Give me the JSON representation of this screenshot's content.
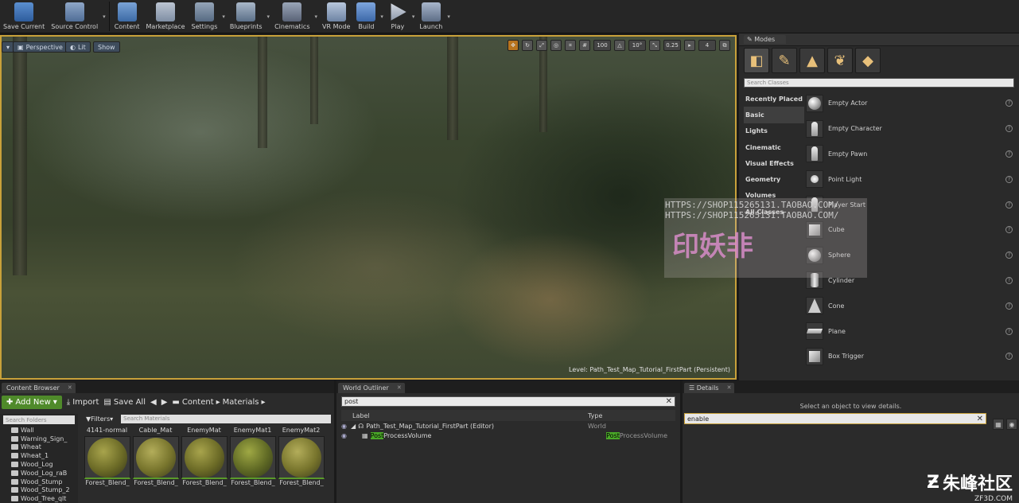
{
  "toolbar": {
    "items": [
      {
        "label": "Save Current",
        "icon": "save-icon"
      },
      {
        "label": "Source Control",
        "icon": "source-control-icon"
      },
      {
        "label": "Content",
        "icon": "content-icon"
      },
      {
        "label": "Marketplace",
        "icon": "marketplace-icon"
      },
      {
        "label": "Settings",
        "icon": "settings-icon"
      },
      {
        "label": "Blueprints",
        "icon": "blueprints-icon"
      },
      {
        "label": "Cinematics",
        "icon": "cinematics-icon"
      },
      {
        "label": "VR Mode",
        "icon": "vr-mode-icon"
      },
      {
        "label": "Build",
        "icon": "build-icon"
      },
      {
        "label": "Play",
        "icon": "play-icon"
      },
      {
        "label": "Launch",
        "icon": "launch-icon"
      }
    ]
  },
  "viewport": {
    "perspective_label": "Perspective",
    "lit_label": "Lit",
    "show_label": "Show",
    "grid_snap": "100",
    "rotate_snap": "10°",
    "scale_snap": "0.25",
    "camera_speed": "4",
    "level_label": "Level:  Path_Test_Map_Tutorial_FirstPart (Persistent)"
  },
  "modes": {
    "tab_label": "Modes",
    "search_placeholder": "Search Classes",
    "categories": [
      "Recently Placed",
      "Basic",
      "Lights",
      "Cinematic",
      "Visual Effects",
      "Geometry",
      "Volumes",
      "All Classes"
    ],
    "items": [
      "Empty Actor",
      "Empty Character",
      "Empty Pawn",
      "Point Light",
      "Player Start",
      "Cube",
      "Sphere",
      "Cylinder",
      "Cone",
      "Plane",
      "Box Trigger"
    ]
  },
  "content_browser": {
    "tab_label": "Content Browser",
    "add_new": "Add New",
    "import": "Import",
    "save_all": "Save All",
    "crumb_content": "Content",
    "crumb_materials": "Materials",
    "folder_search_placeholder": "Search Folders",
    "folders": [
      "Wall",
      "Warning_Sign_",
      "Wheat",
      "Wheat_1",
      "Wood_Log",
      "Wood_Log_raB",
      "Wood_Stump",
      "Wood_Stump_2",
      "Wood_Tree_qlt"
    ],
    "filters_label": "Filters",
    "asset_search_placeholder": "Search Materials",
    "top_names": [
      "4141-normal",
      "Cable_Mat",
      "EnemyMat",
      "EnemyMat1",
      "EnemyMat2"
    ],
    "tile_captions": [
      "Forest_Blend_",
      "Forest_Blend_",
      "Forest_Blend_",
      "Forest_Blend_",
      "Forest_Blend_"
    ]
  },
  "world_outliner": {
    "tab_label": "World Outliner",
    "search_value": "post",
    "col_label": "Label",
    "col_type": "Type",
    "rows": [
      {
        "name": "Path_Test_Map_Tutorial_FirstPart (Editor)",
        "type": "World"
      },
      {
        "name_hl": "Post",
        "name_rest": "ProcessVolume",
        "type_hl": "Post",
        "type_rest": "ProcessVolume"
      }
    ]
  },
  "details": {
    "tab_label": "Details",
    "message": "Select an object to view details.",
    "search_value": "enable"
  },
  "overlay": {
    "watermark_line1": "HTTPS://SHOP115265131.TAOBAO.COM/",
    "watermark_line2": "HTTPS://SHOP115265131.TAOBAO.COM/",
    "brand_name": "朱峰社区",
    "brand_url": "ZF3D.COM"
  }
}
